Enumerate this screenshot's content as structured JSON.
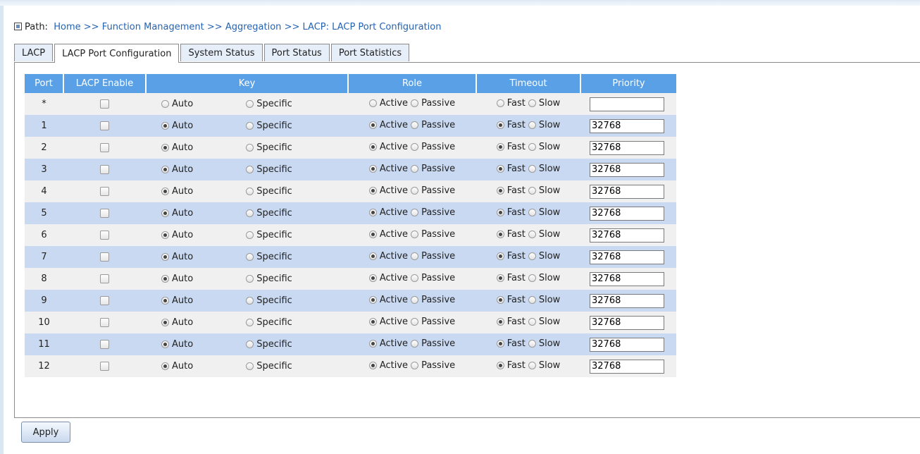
{
  "path": {
    "label": "Path:",
    "crumbs": [
      "Home",
      "Function Management",
      "Aggregation",
      "LACP"
    ],
    "separator": ">>",
    "current_sep": ":",
    "current": "LACP Port Configuration"
  },
  "tabs": [
    "LACP",
    "LACP Port Configuration",
    "System Status",
    "Port Status",
    "Port Statistics"
  ],
  "active_tab": 1,
  "table": {
    "headers": {
      "port": "Port",
      "lacp_enable": "LACP Enable",
      "key": "Key",
      "role": "Role",
      "timeout": "Timeout",
      "priority": "Priority"
    },
    "options": {
      "auto": "Auto",
      "specific": "Specific",
      "active": "Active",
      "passive": "Passive",
      "fast": "Fast",
      "slow": "Slow"
    },
    "rows": [
      {
        "port": "*",
        "enabled": false,
        "key": null,
        "role": null,
        "timeout": null,
        "priority": ""
      },
      {
        "port": "1",
        "enabled": false,
        "key": "auto",
        "role": "active",
        "timeout": "fast",
        "priority": "32768"
      },
      {
        "port": "2",
        "enabled": false,
        "key": "auto",
        "role": "active",
        "timeout": "fast",
        "priority": "32768"
      },
      {
        "port": "3",
        "enabled": false,
        "key": "auto",
        "role": "active",
        "timeout": "fast",
        "priority": "32768"
      },
      {
        "port": "4",
        "enabled": false,
        "key": "auto",
        "role": "active",
        "timeout": "fast",
        "priority": "32768"
      },
      {
        "port": "5",
        "enabled": false,
        "key": "auto",
        "role": "active",
        "timeout": "fast",
        "priority": "32768"
      },
      {
        "port": "6",
        "enabled": false,
        "key": "auto",
        "role": "active",
        "timeout": "fast",
        "priority": "32768"
      },
      {
        "port": "7",
        "enabled": false,
        "key": "auto",
        "role": "active",
        "timeout": "fast",
        "priority": "32768"
      },
      {
        "port": "8",
        "enabled": false,
        "key": "auto",
        "role": "active",
        "timeout": "fast",
        "priority": "32768"
      },
      {
        "port": "9",
        "enabled": false,
        "key": "auto",
        "role": "active",
        "timeout": "fast",
        "priority": "32768"
      },
      {
        "port": "10",
        "enabled": false,
        "key": "auto",
        "role": "active",
        "timeout": "fast",
        "priority": "32768"
      },
      {
        "port": "11",
        "enabled": false,
        "key": "auto",
        "role": "active",
        "timeout": "fast",
        "priority": "32768"
      },
      {
        "port": "12",
        "enabled": false,
        "key": "auto",
        "role": "active",
        "timeout": "fast",
        "priority": "32768"
      }
    ]
  },
  "apply_label": "Apply",
  "colors": {
    "header_bg": "#5aa0e6",
    "row_alt": "#c9d9f2",
    "row_base": "#f0f0f0",
    "link": "#2463b4"
  }
}
